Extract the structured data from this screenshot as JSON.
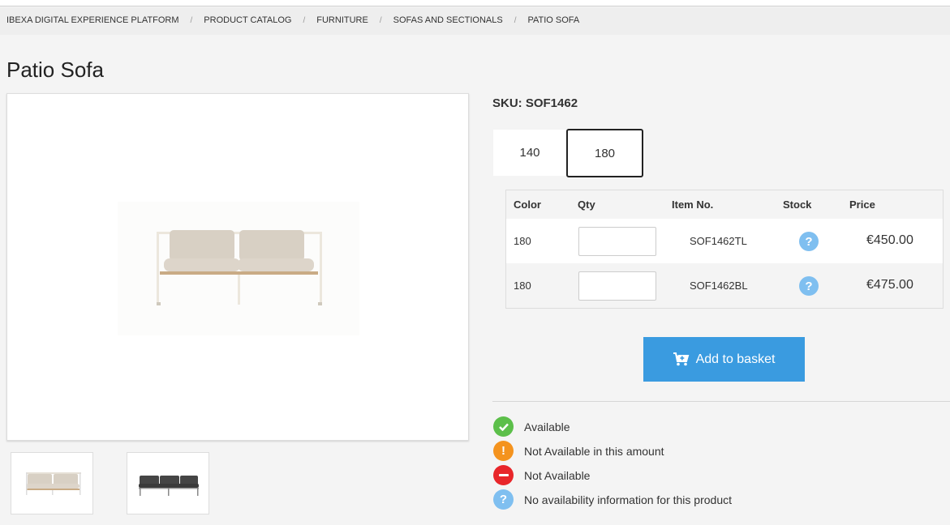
{
  "breadcrumb": [
    {
      "label": "IBEXA DIGITAL EXPERIENCE PLATFORM"
    },
    {
      "label": "PRODUCT CATALOG"
    },
    {
      "label": "FURNITURE"
    },
    {
      "label": "SOFAS AND SECTIONALS"
    },
    {
      "label": "PATIO SOFA"
    }
  ],
  "breadcrumb_separator": "/",
  "product": {
    "title": "Patio Sofa",
    "sku": "SKU: SOF1462"
  },
  "variants": [
    {
      "label": "140",
      "selected": false
    },
    {
      "label": "180",
      "selected": true
    }
  ],
  "variant_table": {
    "headers": {
      "color": "Color",
      "qty": "Qty",
      "item_no": "Item No.",
      "stock": "Stock",
      "price": "Price"
    },
    "rows": [
      {
        "color": "180",
        "qty": "",
        "item_no": "SOF1462TL",
        "stock_icon": "question-icon",
        "price": "€450.00"
      },
      {
        "color": "180",
        "qty": "",
        "item_no": "SOF1462BL",
        "stock_icon": "question-icon",
        "price": "€475.00"
      }
    ]
  },
  "actions": {
    "add_to_basket": "Add to basket"
  },
  "legend": [
    {
      "label": "Available",
      "icon": "check-icon",
      "color": "#5cbf4a"
    },
    {
      "label": "Not Available in this amount",
      "icon": "exclamation-icon",
      "color": "#f4931e"
    },
    {
      "label": "Not Available",
      "icon": "minus-icon",
      "color": "#e8262a"
    },
    {
      "label": "No availability information for this product",
      "icon": "question-icon",
      "color": "#7fbff0"
    }
  ],
  "colors": {
    "accent": "#3a9be0",
    "background": "#f4f4f4"
  }
}
